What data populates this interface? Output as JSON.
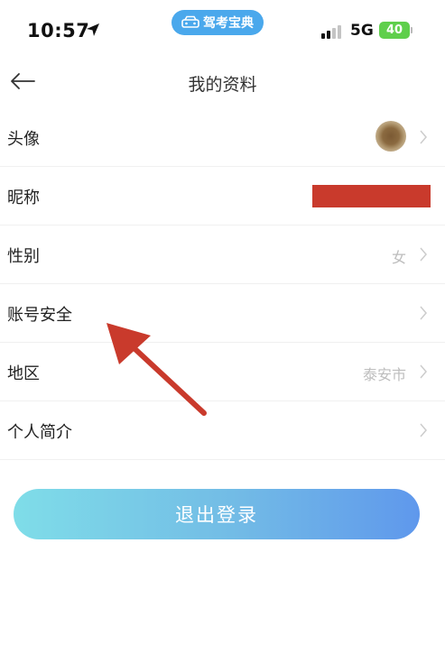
{
  "status_bar": {
    "time": "10:57",
    "app_badge": "驾考宝典",
    "network": "5G",
    "battery": "40"
  },
  "header": {
    "title": "我的资料"
  },
  "profile_rows": [
    {
      "label": "头像",
      "value": ""
    },
    {
      "label": "昵称",
      "value": ""
    },
    {
      "label": "性别",
      "value": "女"
    },
    {
      "label": "账号安全",
      "value": ""
    },
    {
      "label": "地区",
      "value": "泰安市"
    },
    {
      "label": "个人简介",
      "value": ""
    }
  ],
  "logout_label": "退出登录",
  "colors": {
    "app_badge": "#4aa8ec",
    "battery": "#5fcf4c",
    "redaction": "#c93a2c",
    "annotation_arrow": "#c93a2c",
    "logout_gradient_start": "#7fdde8",
    "logout_gradient_end": "#5f98ec"
  }
}
